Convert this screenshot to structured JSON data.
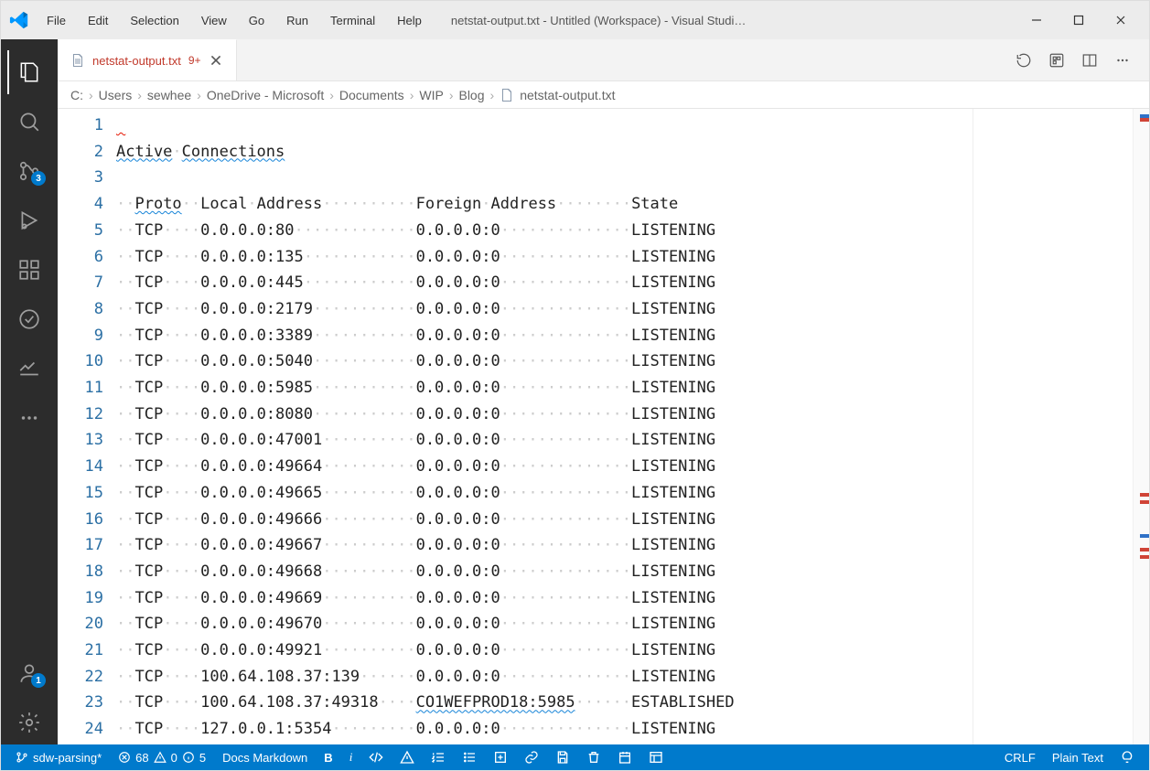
{
  "window": {
    "title": "netstat-output.txt - Untitled (Workspace) - Visual Studi…"
  },
  "menu": [
    "File",
    "Edit",
    "Selection",
    "View",
    "Go",
    "Run",
    "Terminal",
    "Help"
  ],
  "activity": {
    "scm_badge": "3",
    "account_badge": "1"
  },
  "tab": {
    "filename": "netstat-output.txt",
    "dirty": "9+"
  },
  "breadcrumbs": [
    "C:",
    "Users",
    "sewhee",
    "OneDrive - Microsoft",
    "Documents",
    "WIP",
    "Blog",
    "netstat-output.txt"
  ],
  "lines": [
    "",
    "Active Connections",
    "",
    "  Proto  Local Address          Foreign Address        State",
    "  TCP    0.0.0.0:80             0.0.0.0:0              LISTENING",
    "  TCP    0.0.0.0:135            0.0.0.0:0              LISTENING",
    "  TCP    0.0.0.0:445            0.0.0.0:0              LISTENING",
    "  TCP    0.0.0.0:2179           0.0.0.0:0              LISTENING",
    "  TCP    0.0.0.0:3389           0.0.0.0:0              LISTENING",
    "  TCP    0.0.0.0:5040           0.0.0.0:0              LISTENING",
    "  TCP    0.0.0.0:5985           0.0.0.0:0              LISTENING",
    "  TCP    0.0.0.0:8080           0.0.0.0:0              LISTENING",
    "  TCP    0.0.0.0:47001          0.0.0.0:0              LISTENING",
    "  TCP    0.0.0.0:49664          0.0.0.0:0              LISTENING",
    "  TCP    0.0.0.0:49665          0.0.0.0:0              LISTENING",
    "  TCP    0.0.0.0:49666          0.0.0.0:0              LISTENING",
    "  TCP    0.0.0.0:49667          0.0.0.0:0              LISTENING",
    "  TCP    0.0.0.0:49668          0.0.0.0:0              LISTENING",
    "  TCP    0.0.0.0:49669          0.0.0.0:0              LISTENING",
    "  TCP    0.0.0.0:49670          0.0.0.0:0              LISTENING",
    "  TCP    0.0.0.0:49921          0.0.0.0:0              LISTENING",
    "  TCP    100.64.108.37:139      0.0.0.0:0              LISTENING",
    "  TCP    100.64.108.37:49318    CO1WEFPROD18:5985      ESTABLISHED",
    "  TCP    127.0.0.1:5354         0.0.0.0:0              LISTENING"
  ],
  "status": {
    "branch": "sdw-parsing*",
    "errors": "68",
    "warnings": "0",
    "infos": "5",
    "mode": "Docs Markdown",
    "bold": "B",
    "italic": "i",
    "eol": "CRLF",
    "lang": "Plain Text"
  }
}
